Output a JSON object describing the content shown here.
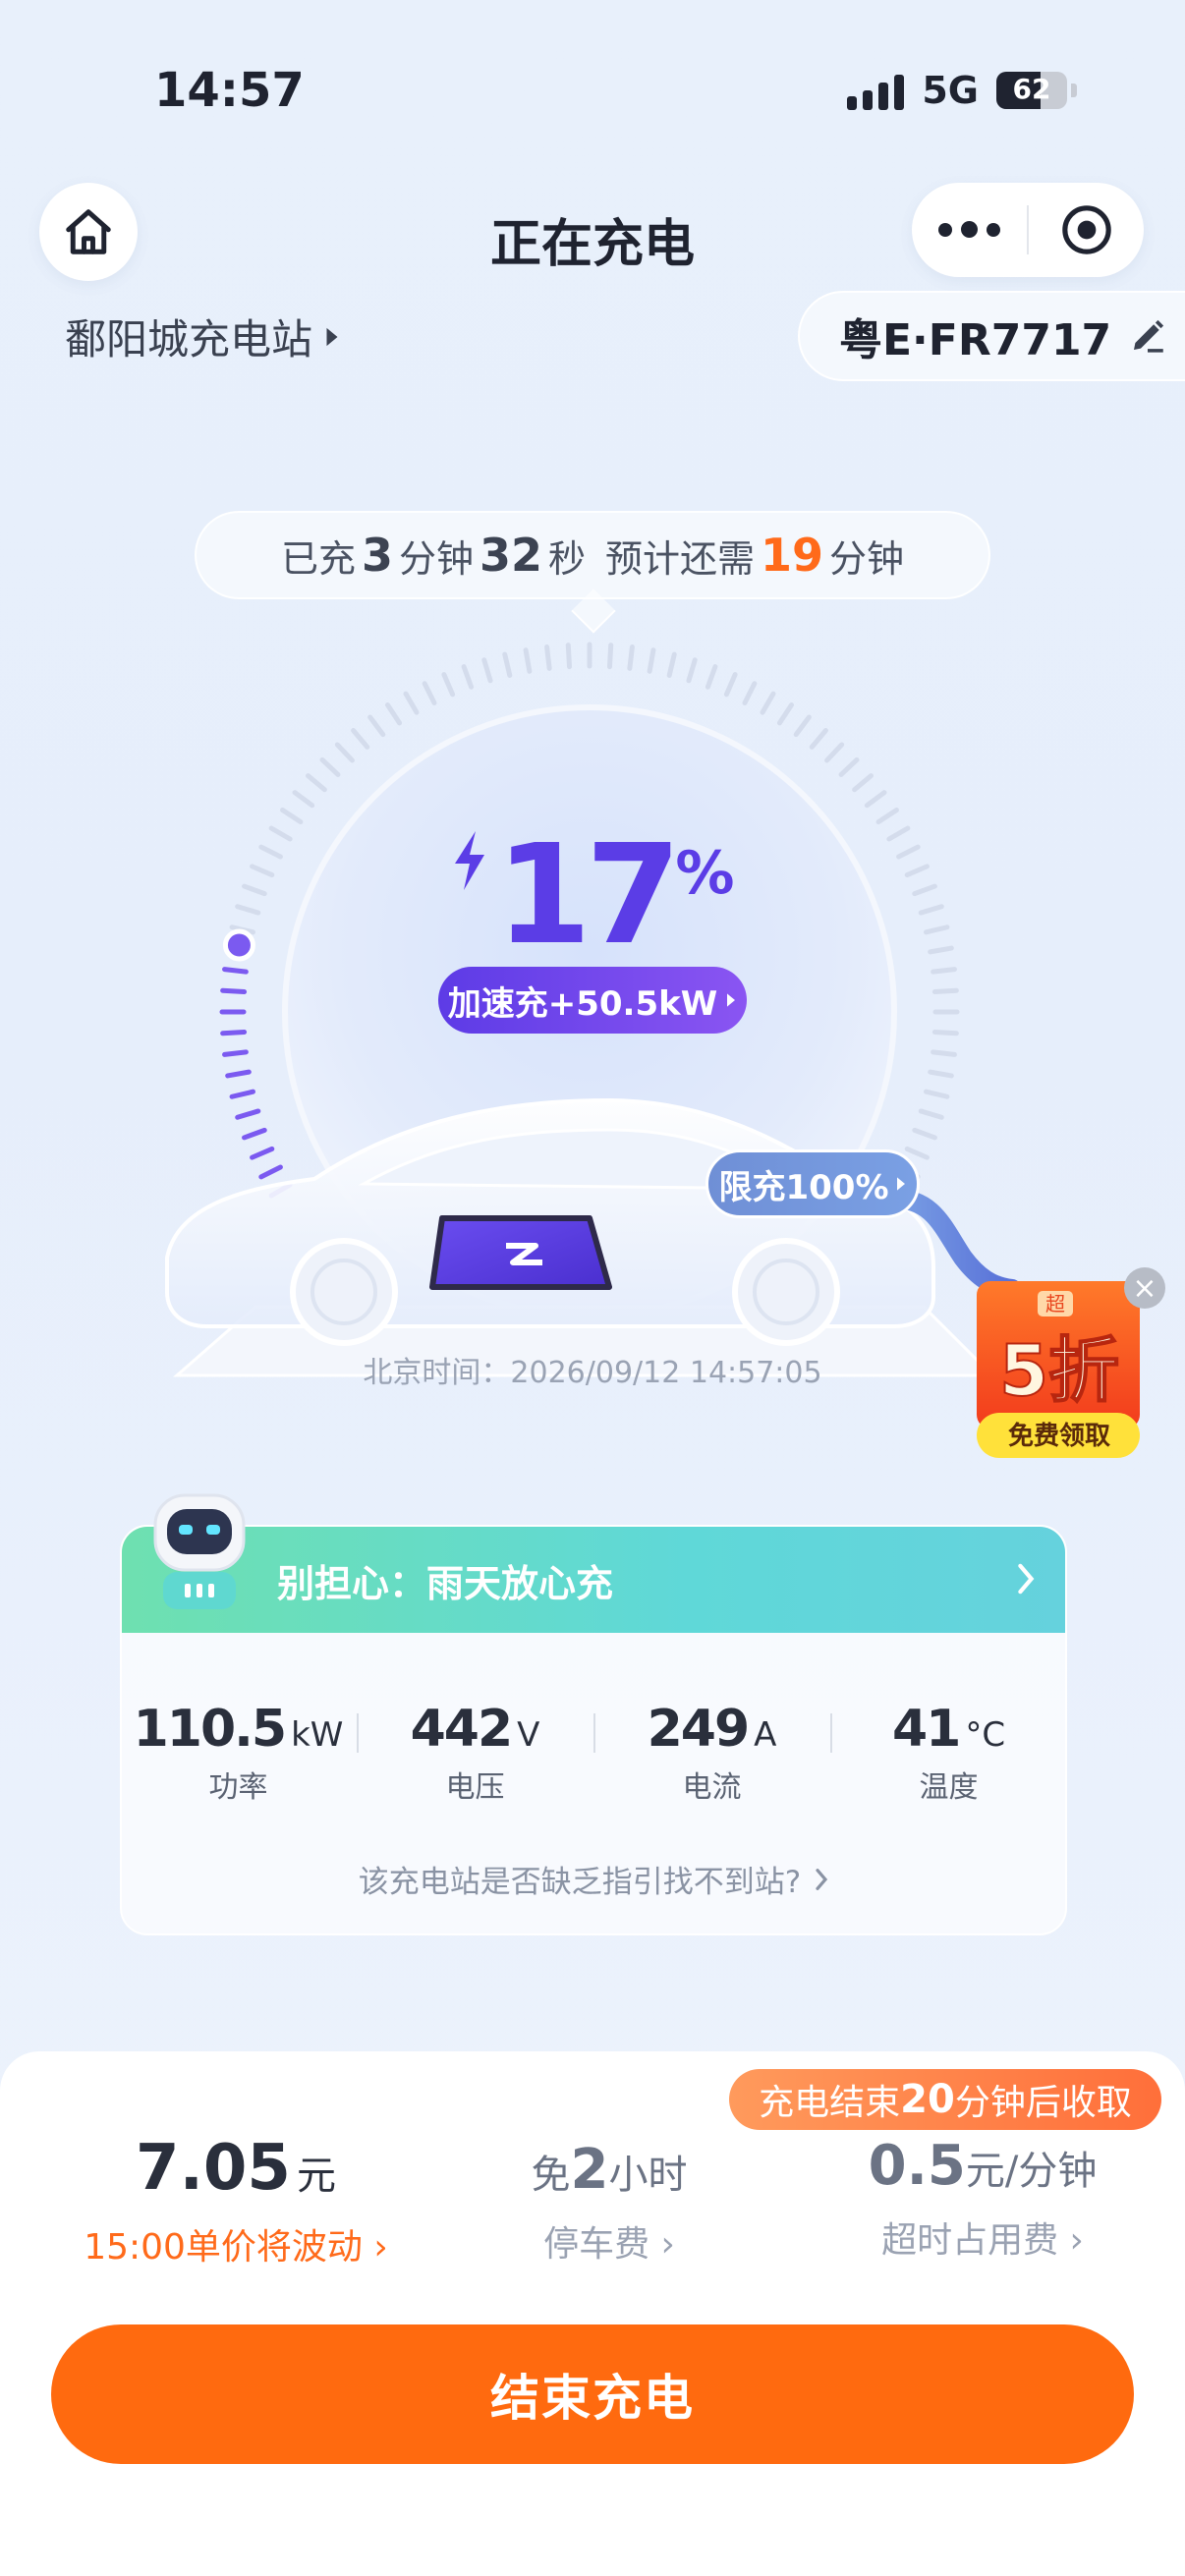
{
  "status_bar": {
    "time": "14:57",
    "network": "5G",
    "battery": "62"
  },
  "header": {
    "title": "正在充电"
  },
  "station": {
    "name": "鄱阳城充电站",
    "plate": "粤E·FR7717"
  },
  "charge_time": {
    "charged_prefix": "已充",
    "charged_min": "3",
    "min_label": "分钟",
    "charged_sec": "32",
    "sec_label": "秒",
    "remaining_prefix": "预计还需",
    "remaining_min": "19",
    "remaining_suffix": "分钟"
  },
  "gauge": {
    "percent": "17",
    "percent_sign": "%",
    "speed_label": "加速充+50.5kW",
    "limit_label": "限充100%"
  },
  "beijing_time": "北京时间：2026/09/12 14:57:05",
  "promo": {
    "discount": "5折",
    "cta": "免费领取",
    "tag": "超"
  },
  "tip_card": {
    "title": "别担心：雨天放心充",
    "stats": [
      {
        "value": "110.5",
        "unit": "kW",
        "label": "功率"
      },
      {
        "value": "442",
        "unit": "V",
        "label": "电压"
      },
      {
        "value": "249",
        "unit": "A",
        "label": "电流"
      },
      {
        "value": "41",
        "unit": "°C",
        "label": "温度"
      }
    ],
    "guide": "该充电站是否缺乏指引找不到站?"
  },
  "fees": {
    "badge": {
      "prefix": "充电结束",
      "minutes": "20",
      "suffix": "分钟后收取"
    },
    "charge": {
      "value": "7.05",
      "unit": "元",
      "sub": "15:00单价将波动"
    },
    "parking": {
      "prefix": "免",
      "value": "2",
      "unit": "小时",
      "sub": "停车费"
    },
    "overtime": {
      "value": "0.5",
      "unit": "元/分钟",
      "sub": "超时占用费"
    }
  },
  "end_button": "结束充电",
  "colors": {
    "accent_orange": "#ff6a0f",
    "gauge_purple": "#5b3de6",
    "card_green": "#6ee0b0"
  }
}
